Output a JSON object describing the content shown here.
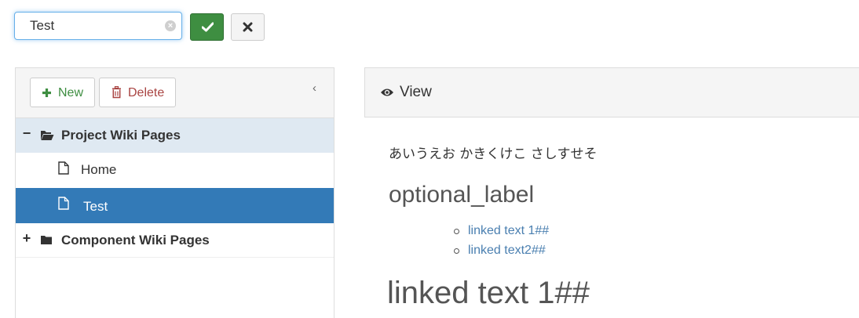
{
  "editor": {
    "title_value": "Test",
    "ok_icon": "check-icon",
    "cancel_icon": "times-icon"
  },
  "sidebar": {
    "new_label": "New",
    "delete_label": "Delete",
    "collapse_glyph": "‹",
    "tree": {
      "project": {
        "expander": "−",
        "label": "Project Wiki Pages"
      },
      "home": {
        "label": "Home"
      },
      "test": {
        "label": "Test"
      },
      "component": {
        "expander": "+",
        "label": "Component Wiki Pages"
      }
    }
  },
  "view": {
    "header_label": "View",
    "paragraph": "あいうえお かきくけこ さしすせそ",
    "heading2": "optional_label",
    "links": [
      "linked text 1##",
      "linked text2##"
    ],
    "heading1": "linked text 1##"
  },
  "colors": {
    "accent": "#337ab7",
    "success": "#3e8e41",
    "danger": "#a94442",
    "link": "#4a7fb0"
  }
}
